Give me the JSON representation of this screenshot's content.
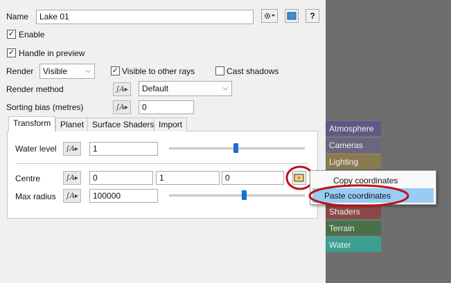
{
  "name": {
    "label": "Name",
    "value": "Lake 01"
  },
  "toolbar": {
    "help_label": "?"
  },
  "enable": {
    "label": "Enable",
    "checked": true
  },
  "handle_preview": {
    "label": "Handle in preview",
    "checked": true
  },
  "render": {
    "label": "Render",
    "value": "Visible"
  },
  "visible_to_rays": {
    "label": "Visible to other rays",
    "checked": true
  },
  "cast_shadows": {
    "label": "Cast shadows",
    "checked": false
  },
  "render_method": {
    "label": "Render method",
    "value": "Default"
  },
  "sorting_bias": {
    "label": "Sorting bias (metres)",
    "value": "0"
  },
  "tabs": [
    {
      "label": "Transform",
      "active": true
    },
    {
      "label": "Planet",
      "active": false
    },
    {
      "label": "Surface Shaders",
      "active": false
    },
    {
      "label": "Import",
      "active": false
    }
  ],
  "water_level": {
    "label": "Water level",
    "value": "1",
    "slider_fraction": 0.49
  },
  "centre": {
    "label": "Centre",
    "x": "0",
    "y": "1",
    "z": "0"
  },
  "max_radius": {
    "label": "Max radius",
    "value": "100000",
    "slider_fraction": 0.55
  },
  "context_menu": {
    "items": [
      "Copy coordinates",
      "Paste coordinates"
    ],
    "highlighted": 1
  },
  "side_buttons": [
    {
      "label": "Atmosphere",
      "color": "#5b5a84"
    },
    {
      "label": "Cameras",
      "color": "#6a6680"
    },
    {
      "label": "Lighting",
      "color": "#8a7a50"
    },
    {
      "label": "Shaders",
      "color": "#8a4848"
    },
    {
      "label": "Terrain",
      "color": "#4a7048"
    },
    {
      "label": "Water",
      "color": "#3a9e90"
    }
  ],
  "colors": {
    "highlight_circle": "#c0101a",
    "menu_highlight": "#99ccf3",
    "slider_thumb": "#1a6ecf"
  },
  "icons": [
    "gear-icon",
    "preview-icon",
    "help-icon",
    "function-icon",
    "chevron-down-icon",
    "coordinates-icon"
  ]
}
